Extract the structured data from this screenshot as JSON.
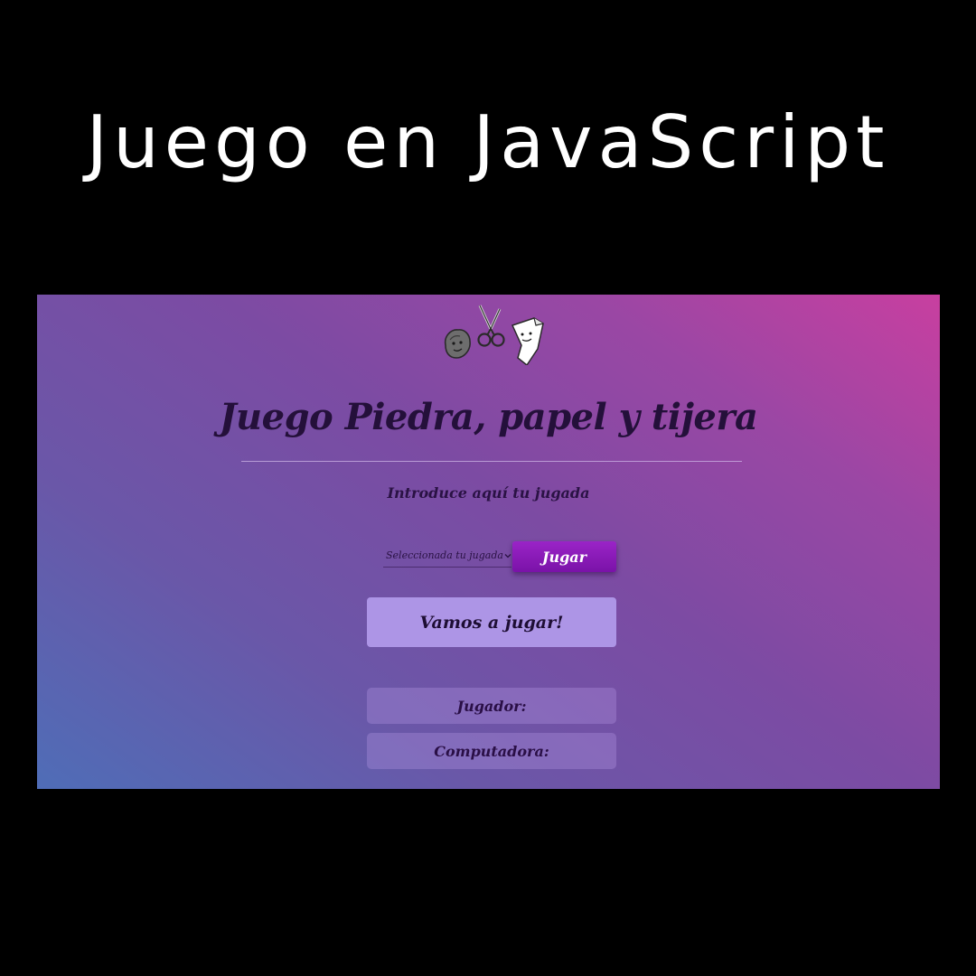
{
  "cover": {
    "title": "Juego en JavaScript"
  },
  "app": {
    "logo_icons": [
      "rock-icon",
      "scissors-icon",
      "paper-icon"
    ],
    "title": "Juego Piedra, papel y tijera",
    "instruction": "Introduce aquí tu jugada",
    "select": {
      "selected_value": "Seleccionada tu jugada"
    },
    "play_button_label": "Jugar",
    "result_message": "Vamos a jugar!",
    "scores": {
      "player_label": "Jugador:",
      "computer_label": "Computadora:"
    },
    "colors": {
      "gradient_start": "#4f6db7",
      "gradient_end": "#c83fa0",
      "button": "#8a1ab8",
      "result_box": "#ad95e6",
      "title_text": "#24103a"
    }
  }
}
